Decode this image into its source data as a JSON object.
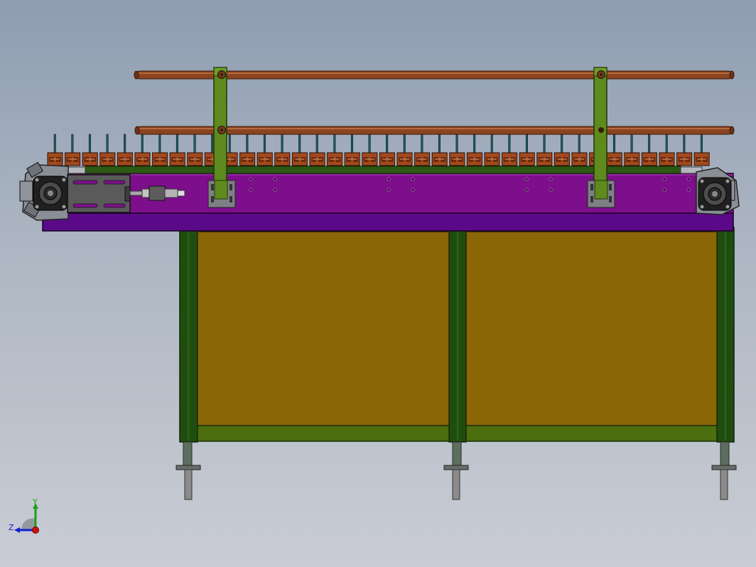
{
  "view": {
    "title": "",
    "background_top": "#8e9db1",
    "background_bottom": "#c9ccd4"
  },
  "model": {
    "name": "",
    "colors": {
      "rail": "#8a4420",
      "rail_highlight": "#b8693c",
      "post": "#5e8a1e",
      "frame_purple": "#7d0e8c",
      "base_purple": "#5a0a88",
      "leg_green": "#1f4d0f",
      "crossbar_green": "#4c6e0e",
      "panel_olive": "#8a6606",
      "chain_brick": "#a14a1e",
      "motor_grey": "#5a5a5a",
      "foot_grey": "#7b7b7b"
    },
    "chain_link_count": 38,
    "bolt_hole_count": 16
  },
  "triad": {
    "x_label": "",
    "y_label": "Y",
    "z_label": "Z",
    "x_color": "#d01010",
    "y_color": "#19a019",
    "z_color": "#1020d0"
  }
}
